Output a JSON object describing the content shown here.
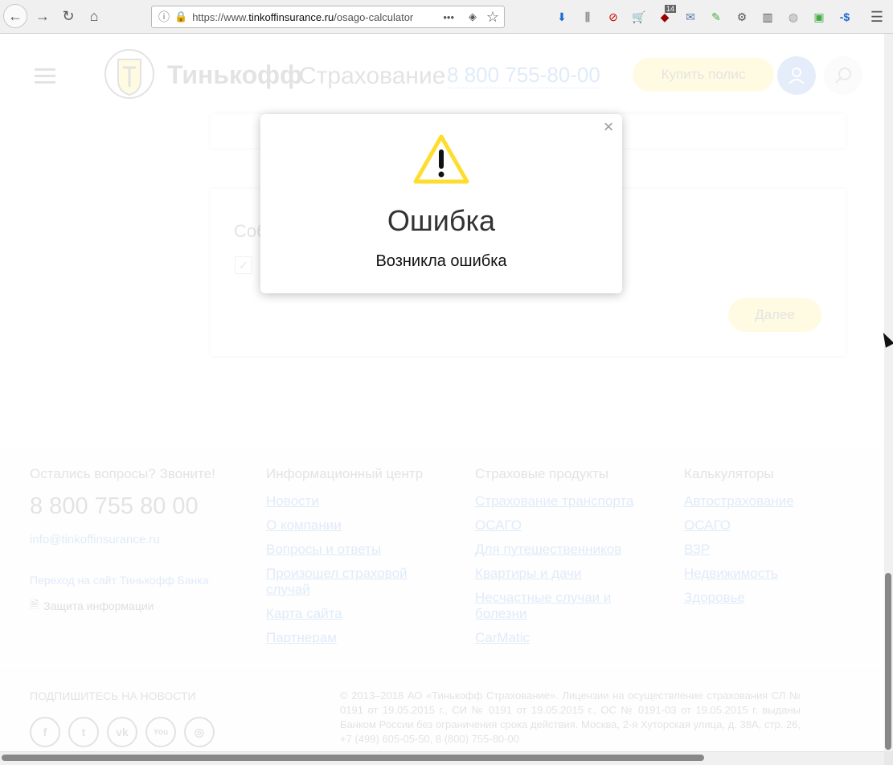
{
  "browser": {
    "url_prefix": "https://www.",
    "url_domain": "tinkoffinsurance.ru",
    "url_path": "/osago-calculator",
    "badge_count": "14"
  },
  "header": {
    "logo_name": "Тинькофф",
    "logo_sub": "Страхование",
    "phone": "8 800 755-80-00",
    "buy_label": "Купить полис"
  },
  "form": {
    "consent_label": "Соб",
    "next_label": "Далее"
  },
  "footer": {
    "contact_heading": "Остались вопросы? Звоните!",
    "contact_phone": "8 800 755 80 00",
    "email": "info@tinkoffinsurance.ru",
    "bank_link": "Переход на сайт Тинькофф Банка",
    "security_link": "Защита информации",
    "columns": [
      {
        "heading": "Информационный центр",
        "links": [
          "Новости",
          "О компании",
          "Вопросы и ответы",
          "Произошел страховой случай",
          "Карта сайта",
          "Партнерам"
        ]
      },
      {
        "heading": "Страховые продукты",
        "links": [
          "Страхование транспорта",
          "ОСАГО",
          "Для путешественников",
          "Квартиры и дачи",
          "Несчастные случаи и болезни",
          "CarMatic"
        ]
      },
      {
        "heading": "Калькуляторы",
        "links": [
          "Автострахование",
          "ОСАГО",
          "ВЗР",
          "Недвижимость",
          "Здоровье"
        ]
      }
    ],
    "subscribe": "ПОДПИШИТЕСЬ НА НОВОСТИ",
    "legal": "© 2013–2018 АО «Тинькофф Страхование». Лицензии на осуществление страхования СЛ № 0191 от 19.05.2015 г., СИ № 0191 от 19.05.2015 г., ОС № 0191-03 от 19.05.2015 г. выданы Банком России без ограничения срока действия. Москва, 2-я Хуторская улица, д. 38А, стр. 26, +7 (499) 605-05-50, 8 (800) 755-80-00"
  },
  "modal": {
    "title": "Ошибка",
    "message": "Возникла ошибка"
  },
  "colors": {
    "accent": "#ffdd2d",
    "link": "#1a6bd0",
    "warning": "#ffdd2d"
  }
}
